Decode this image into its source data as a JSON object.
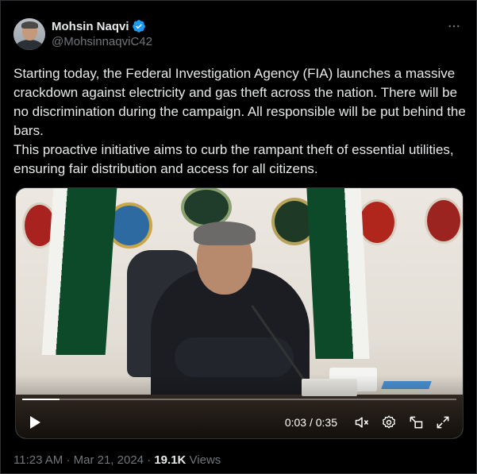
{
  "author": {
    "display_name": "Mohsin Naqvi",
    "handle": "@MohsinnaqviC42",
    "verified": true
  },
  "more_icon": "more-horizontal-icon",
  "text": {
    "line1": "Starting today, the Federal Investigation Agency (FIA) launches a massive crackdown against electricity and gas theft across the nation. There will be no discrimination during the campaign. All responsible will be put behind the bars.",
    "line2": "This proactive initiative aims to curb the rampant theft of essential utilities, ensuring fair distribution and access for all citizens."
  },
  "video": {
    "current_time": "0:03",
    "separator": " / ",
    "duration": "0:35",
    "progress": 0.086,
    "controls": [
      "play-icon",
      "mute-icon",
      "settings-icon",
      "pip-icon",
      "fullscreen-icon"
    ]
  },
  "meta": {
    "time": "11:23 AM",
    "dot1": " · ",
    "date": "Mar 21, 2024",
    "dot2": " · ",
    "views_count": "19.1K",
    "views_label": " Views"
  },
  "colors": {
    "background": "#000000",
    "text": "#e7e9ea",
    "secondary": "#71767b",
    "verified": "#1d9bf0"
  }
}
